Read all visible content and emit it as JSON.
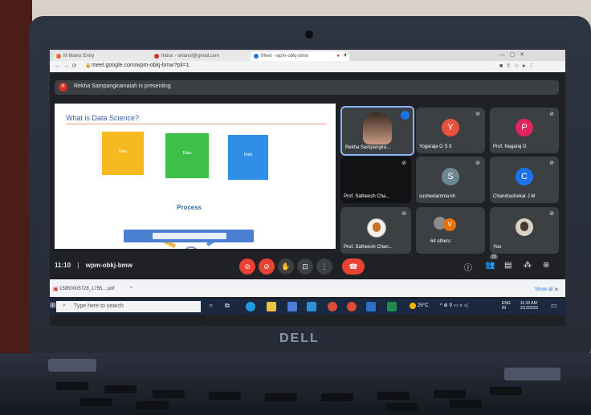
{
  "browser": {
    "tabs": [
      {
        "label": "M Mains Entry",
        "color": "#e66a32"
      },
      {
        "label": "Inbox - srilansl@gmail.com",
        "color": "#d93025"
      },
      {
        "label": "Meet - wpm-obkj-bmw",
        "color": "#1a73e8"
      }
    ],
    "new_tab": "+",
    "address": "meet.google.com/wpm-obkj-bmw?pli=1"
  },
  "meet": {
    "presenting_text": "Rekha Sampangiramaiah is presenting",
    "presenter_initial": "R",
    "slide": {
      "title": "What is Data Science?",
      "boxes": [
        "Data",
        "Data",
        "Data"
      ],
      "process_label": "Process"
    },
    "participants": [
      {
        "name": "Rekha Sampangira...",
        "initial": "",
        "color": ""
      },
      {
        "name": "Yogaraja G S It",
        "initial": "Y",
        "color": "#e8513b"
      },
      {
        "name": "Prof. Nagaraj G",
        "initial": "P",
        "color": "#e0245e"
      },
      {
        "name": "Prof. Satheesh Cha...",
        "initial": "",
        "color": ""
      },
      {
        "name": "susheelamma kh",
        "initial": "S",
        "color": "#6d8893"
      },
      {
        "name": "Chandrashekar J M",
        "initial": "C",
        "color": "#1a73e8"
      },
      {
        "name": "Prof. Satheesh Chan...",
        "initial": "",
        "color": ""
      },
      {
        "name": "64 others",
        "initial": "V",
        "color": "#e8710a"
      },
      {
        "name": "You",
        "initial": "",
        "color": ""
      }
    ],
    "time": "11:10",
    "separator": "|",
    "meeting_code": "wpm-obkj-bmw",
    "participant_count": "73"
  },
  "downloads": {
    "file": "15850005728_1755....pdf",
    "show_all": "Show all"
  },
  "taskbar": {
    "search_placeholder": "Type here to search",
    "temperature": "25°C",
    "language": "ENG",
    "region": "IN",
    "clock_time": "11:10 AM",
    "clock_date": "2/12/2022"
  },
  "laptop_brand": "DELL"
}
